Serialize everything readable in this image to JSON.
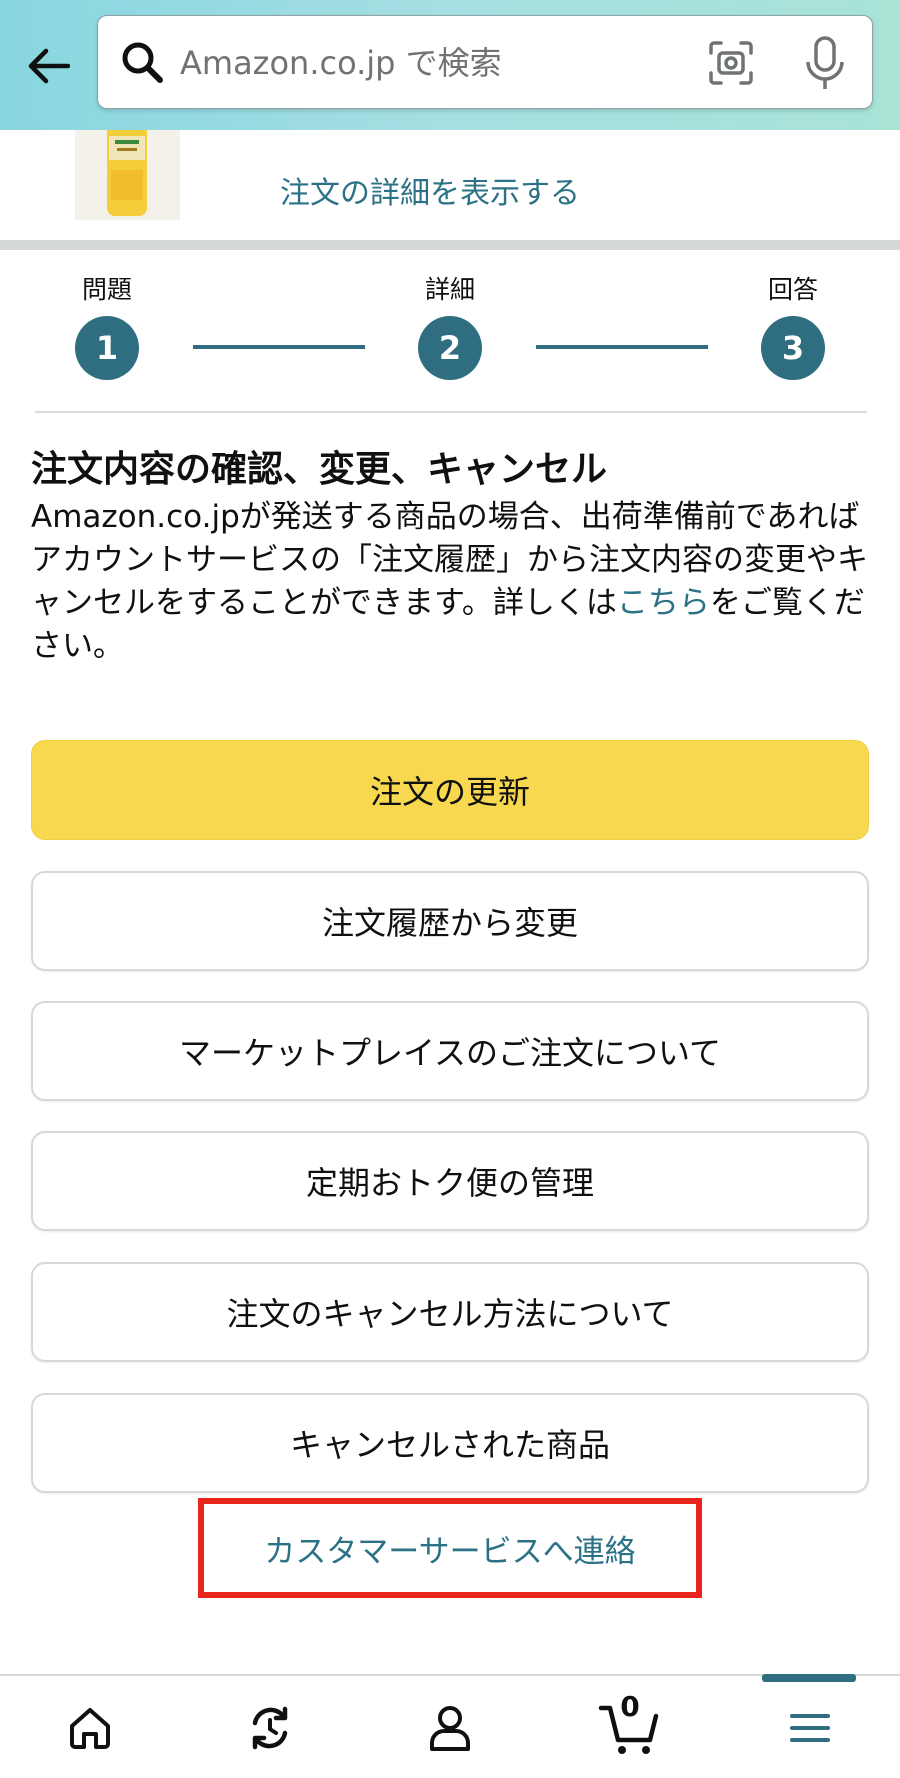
{
  "search": {
    "placeholder": "Amazon.co.jp で検索"
  },
  "order": {
    "detail_link": "注文の詳細を表示する"
  },
  "stepper": {
    "steps": [
      {
        "label": "問題",
        "number": "1"
      },
      {
        "label": "詳細",
        "number": "2"
      },
      {
        "label": "回答",
        "number": "3"
      }
    ]
  },
  "section": {
    "title": "注文内容の確認、変更、キャンセル",
    "body_before_link": "Amazon.co.jpが発送する商品の場合、出荷準備前であればアカウントサービスの「注文履歴」から注文内容の変更やキャンセルをすることができます。詳しくは",
    "link_text": "こちら",
    "body_after_link": "をご覧ください。"
  },
  "buttons": {
    "primary": "注文の更新",
    "options": [
      "注文履歴から変更",
      "マーケットプレイスのご注文について",
      "定期おトク便の管理",
      "注文のキャンセル方法について",
      "キャンセルされた商品"
    ]
  },
  "contact": {
    "link": "カスタマーサービスへ連絡",
    "highlight_color": "#e8261b"
  },
  "bottom_nav": {
    "items": [
      "home-icon",
      "refresh-icon",
      "account-icon",
      "cart-icon",
      "menu-icon"
    ],
    "cart_count": "0",
    "active": "menu-icon"
  },
  "colors": {
    "accent_teal": "#2f6e80",
    "link": "#2c7286",
    "primary_button": "#f7d84e"
  }
}
